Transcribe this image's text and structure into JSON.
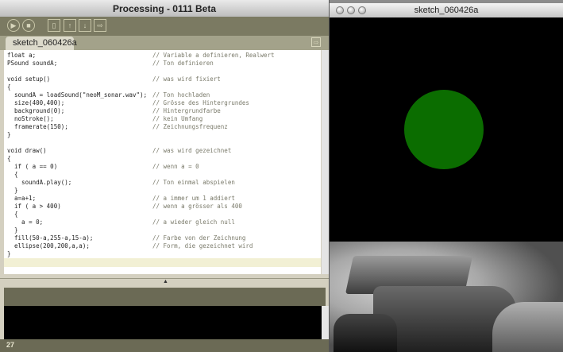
{
  "ide": {
    "title": "Processing - 0111 Beta",
    "tab": "sketch_060426a",
    "line_number": "27",
    "code_lines": [
      "float a;",
      "PSound soundA;",
      "",
      "void setup()",
      "{",
      "  soundA = loadSound(\"neoM_sonar.wav\");",
      "  size(400,400);",
      "  background(0);",
      "  noStroke();",
      "  framerate(150);",
      "}",
      "",
      "void draw()",
      "{",
      "  if ( a == 0)",
      "  {",
      "    soundA.play();",
      "  }",
      "  a=a+1;",
      "  if ( a > 400)",
      "  {",
      "    a = 0;",
      "  }",
      "  fill(50-a,255-a,15-a);",
      "  ellipse(200,200,a,a);",
      "}"
    ],
    "comments": [
      "// Variable a definieren, Realwert",
      "// Ton definieren",
      "",
      "// was wird fixiert",
      "",
      "// Ton hochladen",
      "// Grösse des Hintergrundes",
      "// Hintergrundfarbe",
      "// kein Umfang",
      "// Zeichnungsfrequenz",
      "",
      "",
      "// was wird gezeichnet",
      "",
      "// wenn a = 0",
      "",
      "// Ton einmal abspielen",
      "",
      "// a immer um 1 addiert",
      "// wenn a grösser als 400",
      "",
      "// a wieder gleich null",
      "",
      "// Farbe von der Zeichnung",
      "// Form, die gezeichnet wird",
      ""
    ]
  },
  "sketch": {
    "title": "sketch_060426a",
    "circle_color": "#0b6d00"
  },
  "colors": {
    "toolbar": "#7b7a62",
    "tabs": "#a3a28a",
    "console": "#000000"
  }
}
